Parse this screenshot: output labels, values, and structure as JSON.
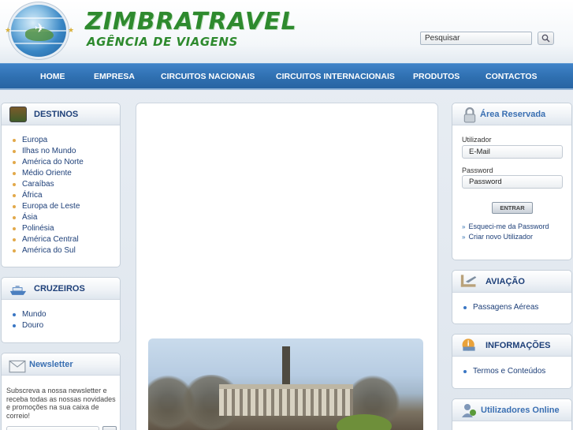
{
  "header": {
    "brand_title": "ZIMBRATRAVEL",
    "brand_subtitle": "AGÊNCIA DE VIAGENS",
    "search_placeholder": "Pesquisar",
    "search_icon": "magnifier-icon"
  },
  "nav": {
    "items": [
      "HOME",
      "EMPRESA",
      "CIRCUITOS NACIONAIS",
      "CIRCUITOS INTERNACIONAIS",
      "PRODUTOS",
      "CONTACTOS"
    ]
  },
  "destinos": {
    "title": "DESTINOS",
    "icon": "destinations-icon",
    "items": [
      "Europa",
      "Ilhas no Mundo",
      "América do Norte",
      "Médio Oriente",
      "Caraíbas",
      "África",
      "Europa de Leste",
      "Ásia",
      "Polinésia",
      "América Central",
      "América do Sul"
    ]
  },
  "cruzeiros": {
    "title": "CRUZEIROS",
    "icon": "ship-icon",
    "items": [
      "Mundo",
      "Douro"
    ]
  },
  "newsletter": {
    "title": "Newsletter",
    "icon": "envelope-icon",
    "text": "Subscreva a nossa newsletter e receba todas as nossas novidades e promoções na sua caixa de correio!"
  },
  "area_reservada": {
    "title": "Área Reservada",
    "icon": "lock-icon",
    "user_label": "Utilizador",
    "user_value": "E-Mail",
    "password_label": "Password",
    "password_value": "Password",
    "submit_label": "ENTRAR",
    "forgot_link": "Esqueci-me da Password",
    "new_user_link": "Criar novo Utilizador"
  },
  "aviacao": {
    "title": "AVIAÇÃO",
    "icon": "airplane-icon",
    "items": [
      "Passagens Aéreas"
    ]
  },
  "informacoes": {
    "title": "INFORMAÇÕES",
    "icon": "info-icon",
    "items": [
      "Termos e Conteúdos"
    ]
  },
  "online": {
    "title": "Utilizadores Online",
    "icon": "users-icon"
  },
  "colors": {
    "nav_bg": "#2f6fb0",
    "brand_green": "#2e8a2e",
    "link_blue": "#1d3f78"
  }
}
